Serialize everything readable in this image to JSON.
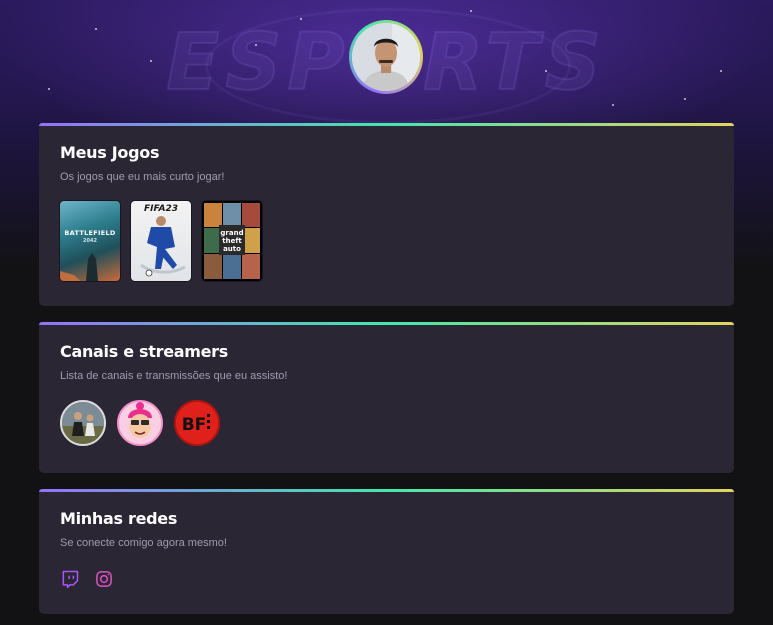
{
  "profile": {
    "avatar_icon": "user-avatar-photo"
  },
  "hero": {
    "watermark": "ESPORTS"
  },
  "games_section": {
    "title": "Meus Jogos",
    "subtitle": "Os jogos que eu mais curto jogar!",
    "games": [
      {
        "name": "Battlefield 2042",
        "cover_text": "BATTLEFIELD",
        "cover_sub": "2042"
      },
      {
        "name": "FIFA 23",
        "cover_text": "FIFA23"
      },
      {
        "name": "Grand Theft Auto V",
        "cover_text": "grand theft auto"
      }
    ]
  },
  "channels_section": {
    "title": "Canais e streamers",
    "subtitle": "Lista de canais e transmissões que eu assisto!",
    "channels": [
      {
        "icon": "channel-avatar-photo"
      },
      {
        "icon": "channel-avatar-cartoon"
      },
      {
        "icon": "channel-avatar-bf-logo",
        "logo_text": "BF"
      }
    ]
  },
  "social_section": {
    "title": "Minhas redes",
    "subtitle": "Se conecte comigo agora mesmo!",
    "links": [
      {
        "icon": "twitch-icon"
      },
      {
        "icon": "instagram-icon"
      }
    ]
  },
  "colors": {
    "background": "#121214",
    "card": "#2a2634",
    "accent_purple": "#9572fc",
    "accent_green": "#43e7ad",
    "accent_yellow": "#e2d45c"
  }
}
